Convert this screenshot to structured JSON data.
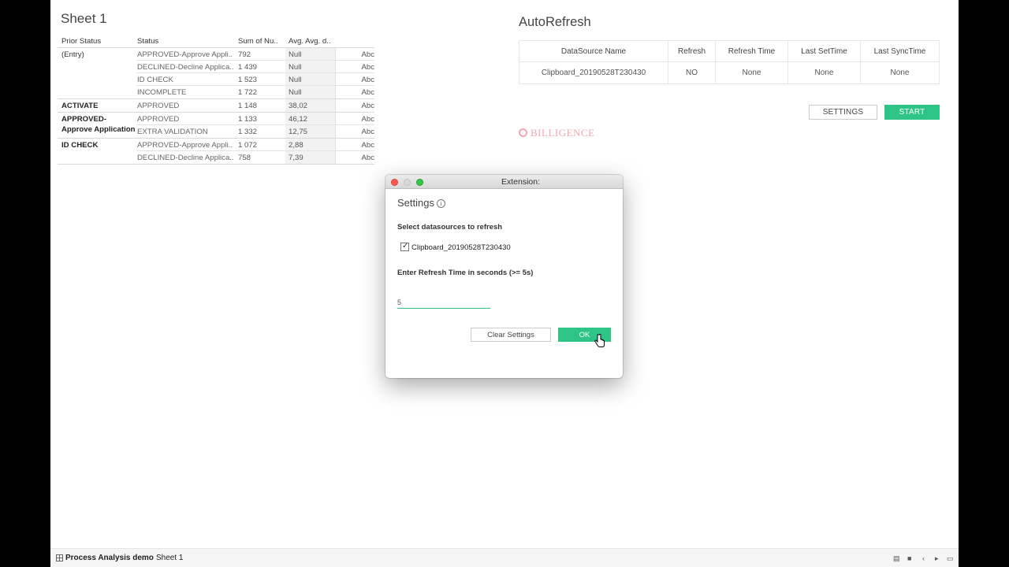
{
  "sheet": {
    "title": "Sheet 1",
    "columns": [
      "Prior Status",
      "Status",
      "Sum of Nu..",
      "Avg. Avg. d.."
    ],
    "groups": [
      {
        "prior_status": "(Entry)",
        "rows": [
          {
            "status": "APPROVED-Approve Appli..",
            "sum": "792",
            "avg": "Null",
            "abc": "Abc"
          },
          {
            "status": "DECLINED-Decline Applica..",
            "sum": "1 439",
            "avg": "Null",
            "abc": "Abc"
          },
          {
            "status": "ID CHECK",
            "sum": "1 523",
            "avg": "Null",
            "abc": "Abc"
          },
          {
            "status": "INCOMPLETE",
            "sum": "1 722",
            "avg": "Null",
            "abc": "Abc"
          }
        ]
      },
      {
        "prior_status": "ACTIVATE",
        "rows": [
          {
            "status": "APPROVED",
            "sum": "1 148",
            "avg": "38,02",
            "abc": "Abc"
          }
        ]
      },
      {
        "prior_status": "APPROVED-Approve Application",
        "rows": [
          {
            "status": "APPROVED",
            "sum": "1 133",
            "avg": "46,12",
            "abc": "Abc"
          },
          {
            "status": "EXTRA VALIDATION",
            "sum": "1 332",
            "avg": "12,75",
            "abc": "Abc"
          }
        ]
      },
      {
        "prior_status": "ID CHECK",
        "rows": [
          {
            "status": "APPROVED-Approve Appli..",
            "sum": "1 072",
            "avg": "2,88",
            "abc": "Abc"
          },
          {
            "status": "DECLINED-Decline Applica..",
            "sum": "758",
            "avg": "7,39",
            "abc": "Abc"
          }
        ]
      }
    ]
  },
  "autorefresh": {
    "title": "AutoRefresh",
    "columns": [
      "DataSource Name",
      "Refresh",
      "Refresh Time",
      "Last SetTime",
      "Last SyncTime"
    ],
    "row": [
      "Clipboard_20190528T230430",
      "NO",
      "None",
      "None",
      "None"
    ],
    "settings_label": "SETTINGS",
    "start_label": "START",
    "logo_text": "BILLIGENCE"
  },
  "dialog": {
    "window_title": "Extension:",
    "heading": "Settings",
    "info_icon": "i",
    "select_label": "Select datasources to refresh",
    "datasource_option": "Clipboard_20190528T230430",
    "datasource_checked": true,
    "time_label": "Enter Refresh Time in seconds (>= 5s)",
    "time_value": "5",
    "clear_label": "Clear Settings",
    "ok_label": "OK"
  },
  "bottombar": {
    "active_tab": "Process Analysis demo",
    "sheet_tab": "Sheet 1"
  },
  "colors": {
    "accent": "#2ec486",
    "logo": "#f0a7b4"
  }
}
